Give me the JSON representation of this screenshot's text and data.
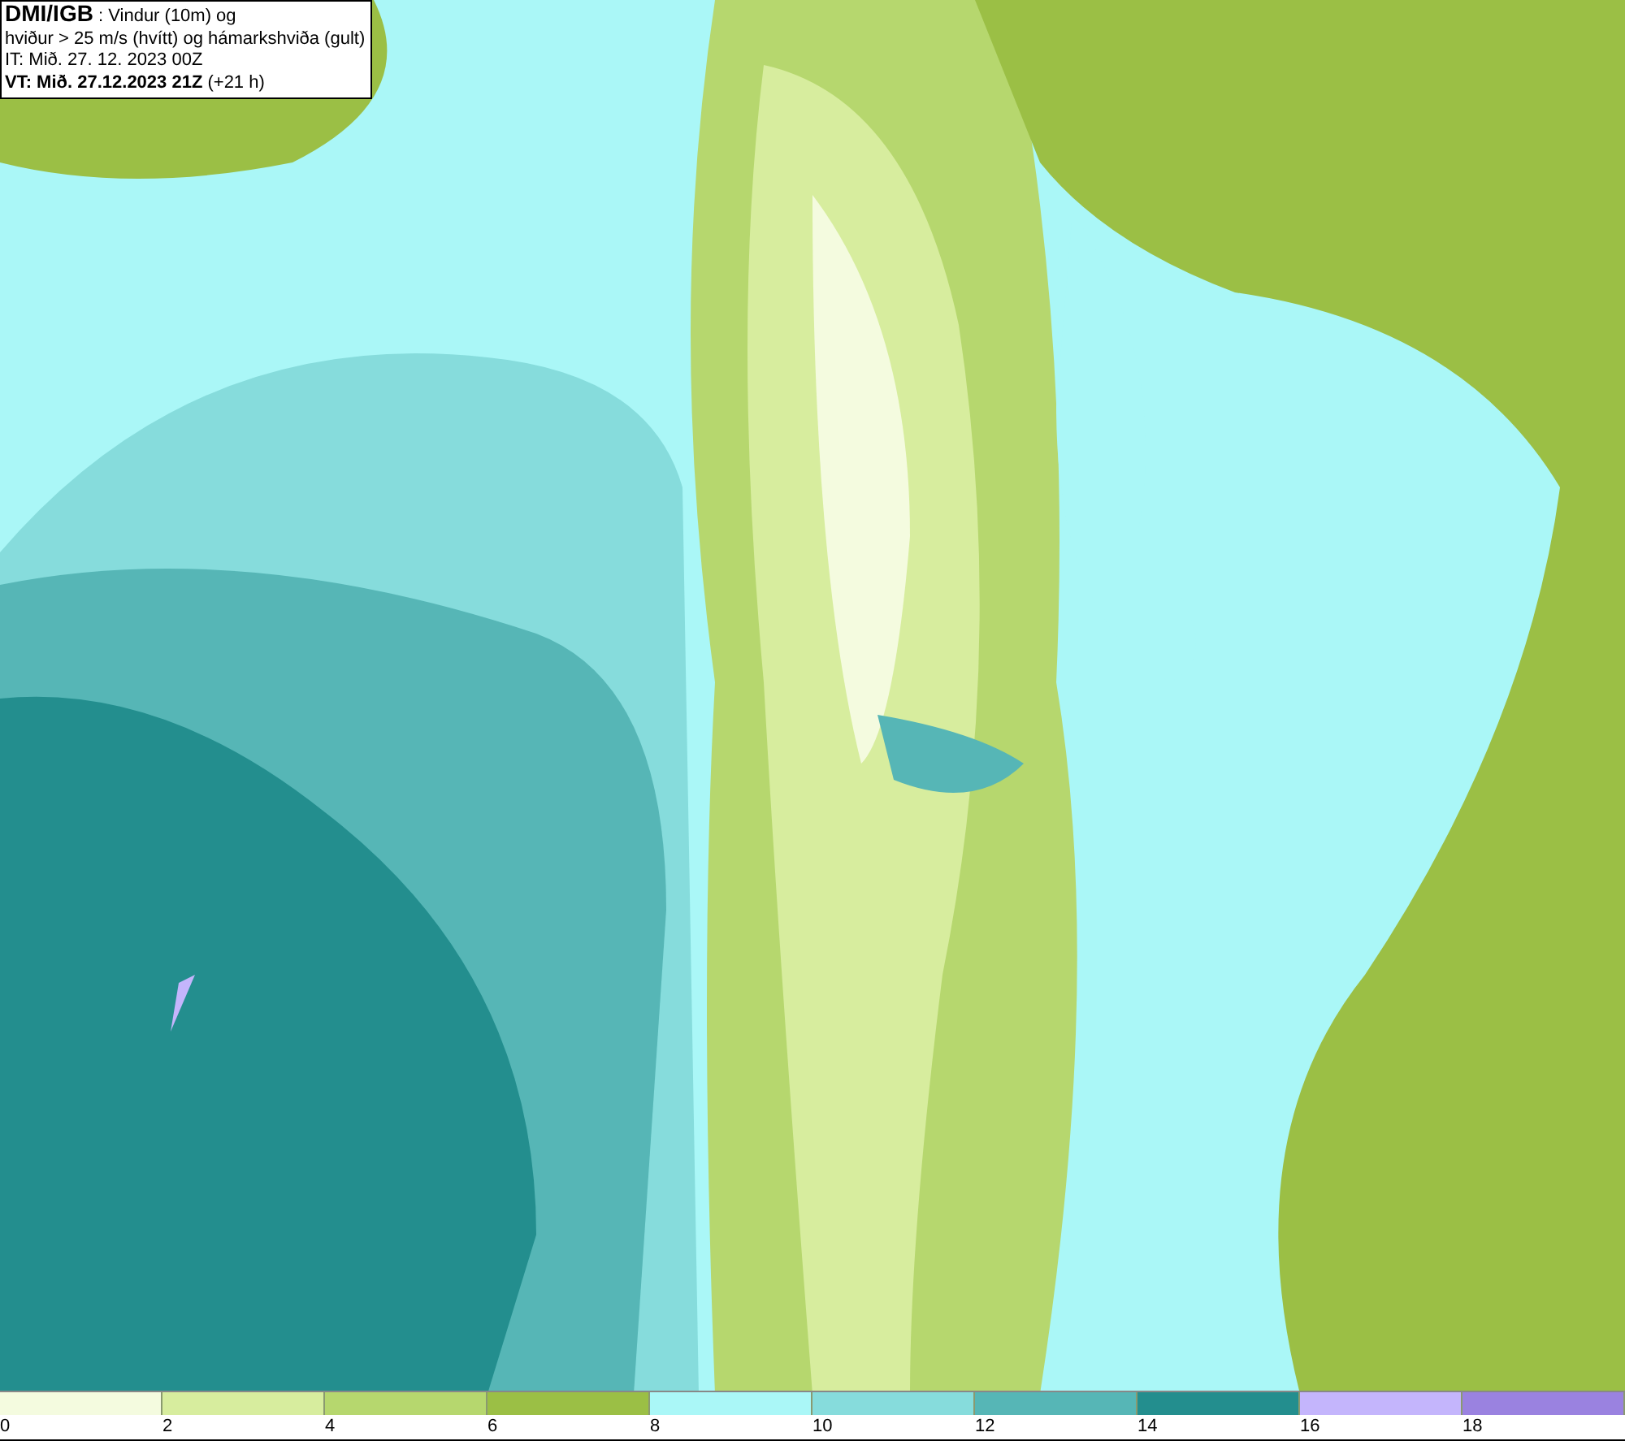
{
  "header": {
    "lines": [
      "**DMI/IGB** : Vindur (10m) og",
      "hviður > 25 m/s (hvítt) og hámarkshviða (gult)",
      "IT: Mið. 27. 12. 2023 00Z",
      "**VT: Mið. 27.12.2023 21Z** (+21 h)"
    ]
  },
  "legend": [
    {
      "label": "0",
      "color": "#f4fbdf"
    },
    {
      "label": "2",
      "color": "#d7ed9e"
    },
    {
      "label": "4",
      "color": "#b6d76e"
    },
    {
      "label": "6",
      "color": "#9bbf45"
    },
    {
      "label": "8",
      "color": "#aaf7f7"
    },
    {
      "label": "10",
      "color": "#86dcdc"
    },
    {
      "label": "12",
      "color": "#56b6b6"
    },
    {
      "label": "14",
      "color": "#238e8e"
    },
    {
      "label": "16",
      "color": "#c4b5fc"
    },
    {
      "label": "18",
      "color": "#9a82e0"
    }
  ]
}
